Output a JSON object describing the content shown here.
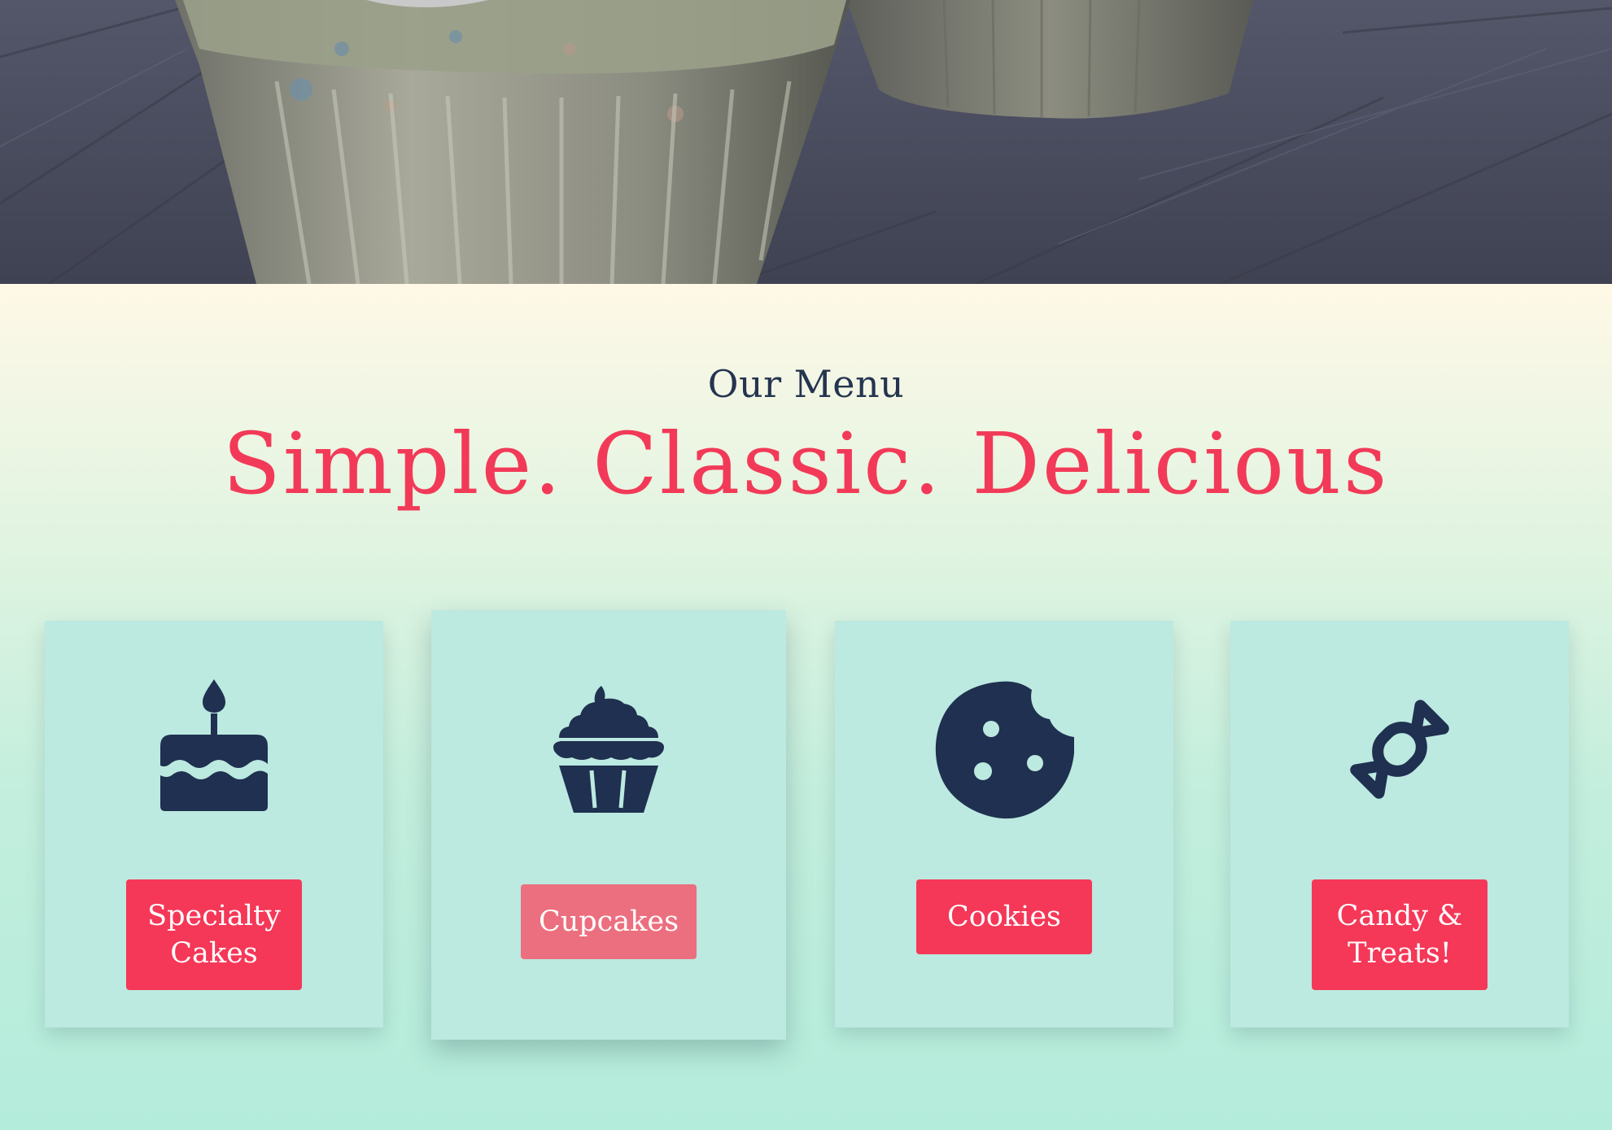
{
  "section": {
    "eyebrow": "Our Menu",
    "headline": "Simple. Classic. Delicious"
  },
  "cards": [
    {
      "icon": "birthday-cake-icon",
      "label": "Specialty Cakes"
    },
    {
      "icon": "cupcake-icon",
      "label": "Cupcakes"
    },
    {
      "icon": "cookie-icon",
      "label": "Cookies"
    },
    {
      "icon": "candy-icon",
      "label": "Candy & Treats!"
    }
  ],
  "colors": {
    "accent": "#f23a58",
    "button": "#f53858",
    "button_hover": "#ec6f7f",
    "icon": "#1f3050",
    "card": "#bce9e0",
    "text_dark": "#25344f"
  }
}
